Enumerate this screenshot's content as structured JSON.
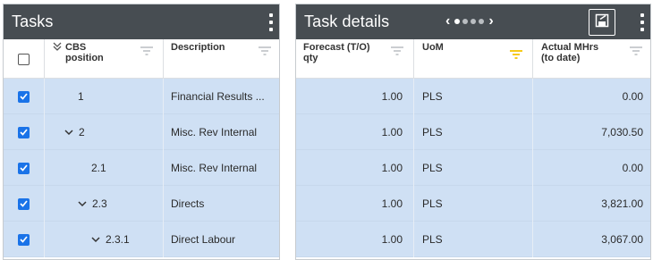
{
  "tasks_panel": {
    "title": "Tasks",
    "columns": {
      "cbs_position": "CBS position",
      "description": "Description"
    },
    "rows": [
      {
        "cbs": "1",
        "description": "Financial Results ...",
        "checked": true,
        "expandable": false
      },
      {
        "cbs": "2",
        "description": "Misc. Rev Internal",
        "checked": true,
        "expandable": true
      },
      {
        "cbs": "2.1",
        "description": "Misc. Rev Internal",
        "checked": true,
        "expandable": false
      },
      {
        "cbs": "2.3",
        "description": "Directs",
        "checked": true,
        "expandable": true
      },
      {
        "cbs": "2.3.1",
        "description": "Direct Labour",
        "checked": true,
        "expandable": true
      }
    ]
  },
  "details_panel": {
    "title": "Task details",
    "columns": {
      "forecast": "Forecast (T/O) qty",
      "uom": "UoM",
      "actual": "Actual MHrs (to date)"
    },
    "rows": [
      {
        "forecast": "1.00",
        "uom": "PLS",
        "actual": "0.00"
      },
      {
        "forecast": "1.00",
        "uom": "PLS",
        "actual": "7,030.50"
      },
      {
        "forecast": "1.00",
        "uom": "PLS",
        "actual": "0.00"
      },
      {
        "forecast": "1.00",
        "uom": "PLS",
        "actual": "3,821.00"
      },
      {
        "forecast": "1.00",
        "uom": "PLS",
        "actual": "3,067.00"
      }
    ]
  },
  "colors": {
    "header_bg": "#474d52",
    "row_selected": "#cfe0f4",
    "checkbox": "#1a73e8",
    "active_filter": "#f5c400"
  },
  "icons": {
    "filter": "filter-icon",
    "kebab": "kebab-icon",
    "save": "save-icon",
    "chevron": "chevron-down-icon"
  }
}
